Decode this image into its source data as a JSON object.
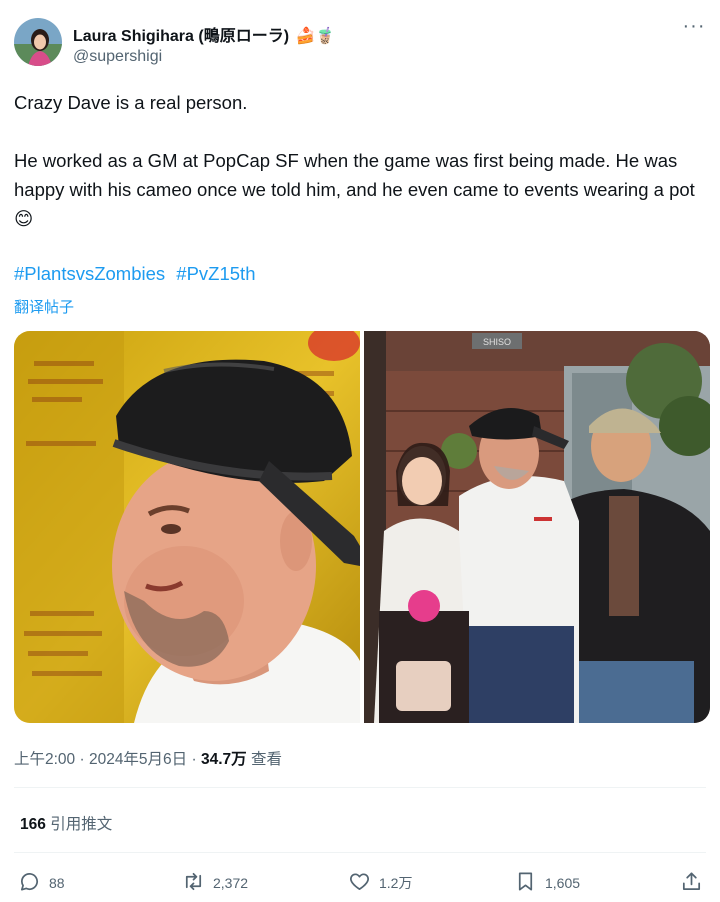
{
  "author": {
    "name": "Laura Shigihara (鴫原ローラ)",
    "name_emojis": "🍰🧋",
    "handle": "@supershigi"
  },
  "menu": {
    "more_label": "···"
  },
  "tweet": {
    "line1": "Crazy Dave is a real person.",
    "line2": "He worked as a GM at PopCap SF when the game was first being made. He was happy with his cameo once we told him, and he even came to events wearing a pot 😊",
    "hashtags": [
      "#PlantsvsZombies",
      "#PvZ15th"
    ],
    "translate_label": "翻译帖子"
  },
  "media": {
    "photo_left": {
      "icon": "photo-man-wearing-pot"
    },
    "photo_right": {
      "icon": "photo-three-people",
      "sign_text": "SHISO"
    }
  },
  "meta": {
    "time": "上午2:00",
    "date": "2024年5月6日",
    "views_count": "34.7万",
    "views_label": "查看"
  },
  "quotes": {
    "count": "166",
    "label": "引用推文"
  },
  "actions": {
    "replies": "88",
    "reposts": "2,372",
    "likes": "1.2万",
    "bookmarks": "1,605"
  },
  "colors": {
    "link": "#1d9bf0",
    "secondary_text": "#536471",
    "primary_text": "#0f1419"
  }
}
